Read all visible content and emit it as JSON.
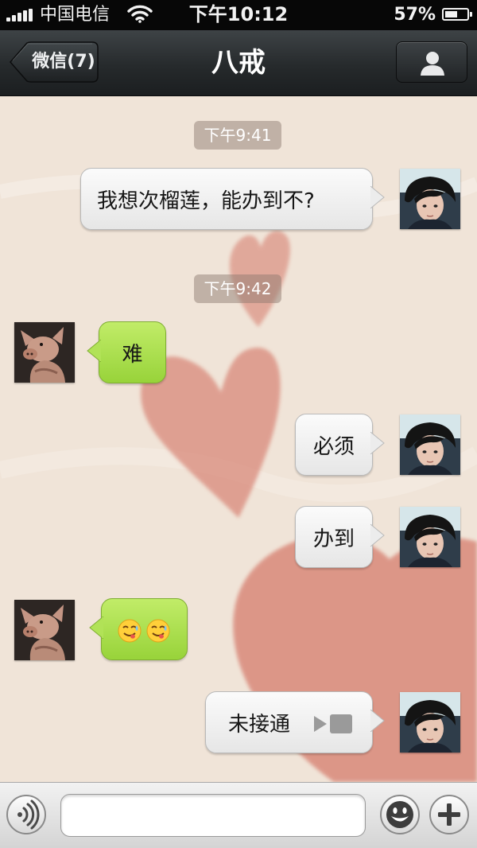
{
  "status_bar": {
    "carrier": "中国电信",
    "time": "下午10:12",
    "battery_percent_label": "57%",
    "battery_level": 0.57,
    "signal_bars": 5
  },
  "nav": {
    "back_label": "微信(7)",
    "title": "八戒",
    "profile_icon": "person-icon"
  },
  "chat": {
    "timestamps": [
      "下午9:41",
      "下午9:42"
    ],
    "messages": [
      {
        "sender": "me",
        "type": "text",
        "text": "我想次榴莲，能办到不?"
      },
      {
        "sender": "bajie",
        "type": "text",
        "text": "难"
      },
      {
        "sender": "me",
        "type": "text",
        "text": "必须"
      },
      {
        "sender": "me",
        "type": "text",
        "text": "办到"
      },
      {
        "sender": "bajie",
        "type": "emoji",
        "text": "😋😋",
        "icons": [
          "yummy-face-icon",
          "yummy-face-icon"
        ]
      },
      {
        "sender": "me",
        "type": "video-call",
        "text": "未接通",
        "icon": "video-camera-icon"
      }
    ]
  },
  "input_bar": {
    "voice_icon": "voice-icon",
    "placeholder": "",
    "emoji_icon": "smiley-icon",
    "plus_icon": "plus-icon"
  },
  "colors": {
    "chat_background": "#f0e4d8",
    "heart": "#d9897a",
    "green_bubble": "#a9df4c",
    "gray_bubble": "#f1f1f1",
    "nav_bar": "#2b2f31"
  }
}
